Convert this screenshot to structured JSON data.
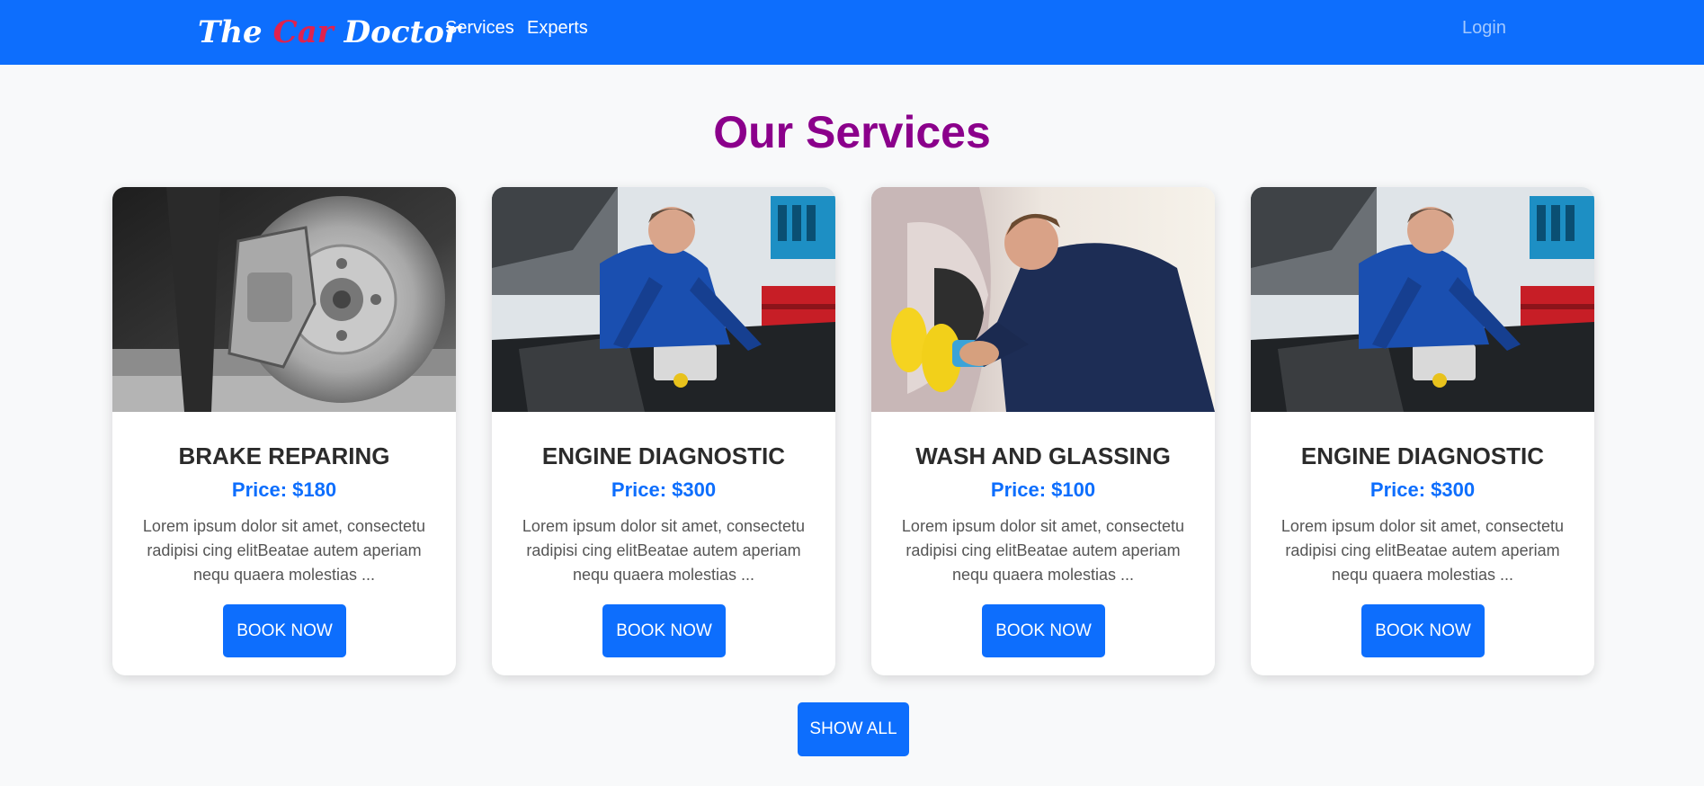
{
  "navbar": {
    "logo_prefix": "The",
    "logo_accent": "Car",
    "logo_suffix": "Doctor",
    "links": [
      "Services",
      "Experts"
    ],
    "login_label": "Login",
    "background_color": "#0d6efd"
  },
  "page": {
    "title": "Our Services",
    "title_color": "#8b008b",
    "show_all_label": "SHOW ALL"
  },
  "services": [
    {
      "name": "BRAKE REPARING",
      "price": "Price: $180",
      "description": "Lorem ipsum dolor sit amet, consectetu radipisi cing elitBeatae autem aperiam nequ quaera molestias ...",
      "button_label": "BOOK NOW",
      "image": "brake-disc-photo"
    },
    {
      "name": "ENGINE DIAGNOSTIC",
      "price": "Price: $300",
      "description": "Lorem ipsum dolor sit amet, consectetu radipisi cing elitBeatae autem aperiam nequ quaera molestias ...",
      "button_label": "BOOK NOW",
      "image": "mechanic-engine-photo"
    },
    {
      "name": "WASH AND GLASSING",
      "price": "Price: $100",
      "description": "Lorem ipsum dolor sit amet, consectetu radipisi cing elitBeatae autem aperiam nequ quaera molestias ...",
      "button_label": "BOOK NOW",
      "image": "car-polishing-photo"
    },
    {
      "name": "ENGINE DIAGNOSTIC",
      "price": "Price: $300",
      "description": "Lorem ipsum dolor sit amet, consectetu radipisi cing elitBeatae autem aperiam nequ quaera molestias ...",
      "button_label": "BOOK NOW",
      "image": "mechanic-engine-photo"
    }
  ]
}
